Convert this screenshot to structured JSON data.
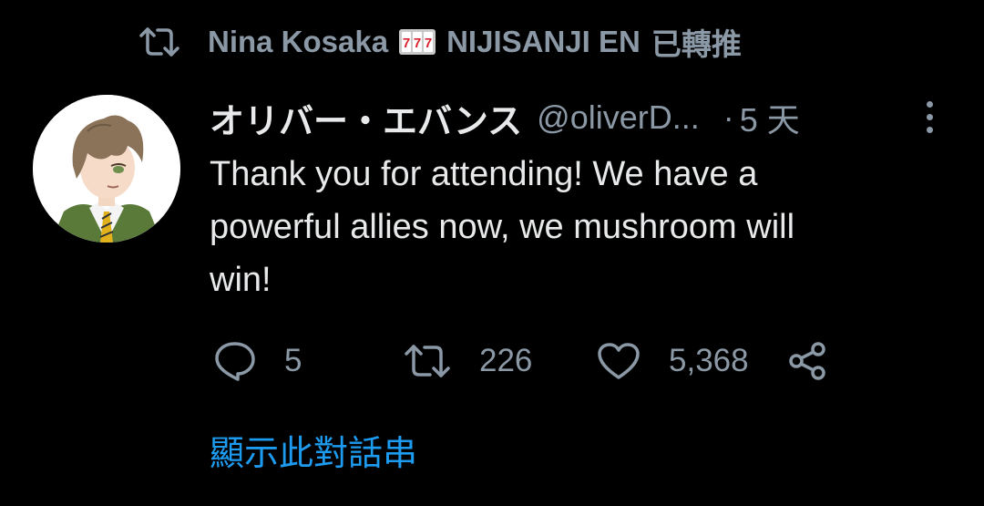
{
  "retweet_context": {
    "icon": "retweet-icon",
    "user_name": "Nina Kosaka",
    "emoji": "slot-machine-777-icon",
    "org": "NIJISANJI EN",
    "suffix": "已轉推"
  },
  "tweet": {
    "author": {
      "display_name": "オリバー・エバンス",
      "handle": "@oliverD...",
      "avatar": "avatar-illustration"
    },
    "separator": "·",
    "timestamp": "5 天",
    "more_icon": "more-options-icon",
    "text_lines": [
      "Thank you for attending! We have a",
      "powerful allies now, we mushroom will",
      "win!"
    ],
    "actions": {
      "reply": {
        "icon": "reply-icon",
        "count": "5"
      },
      "retweet": {
        "icon": "retweet-icon",
        "count": "226"
      },
      "like": {
        "icon": "heart-icon",
        "count": "5,368"
      },
      "share": {
        "icon": "share-icon"
      }
    }
  },
  "show_thread": "顯示此對話串",
  "colors": {
    "background": "#000000",
    "primary_text": "#e7e9ea",
    "secondary_text": "#8b98a5",
    "accent": "#1d9bf0"
  }
}
